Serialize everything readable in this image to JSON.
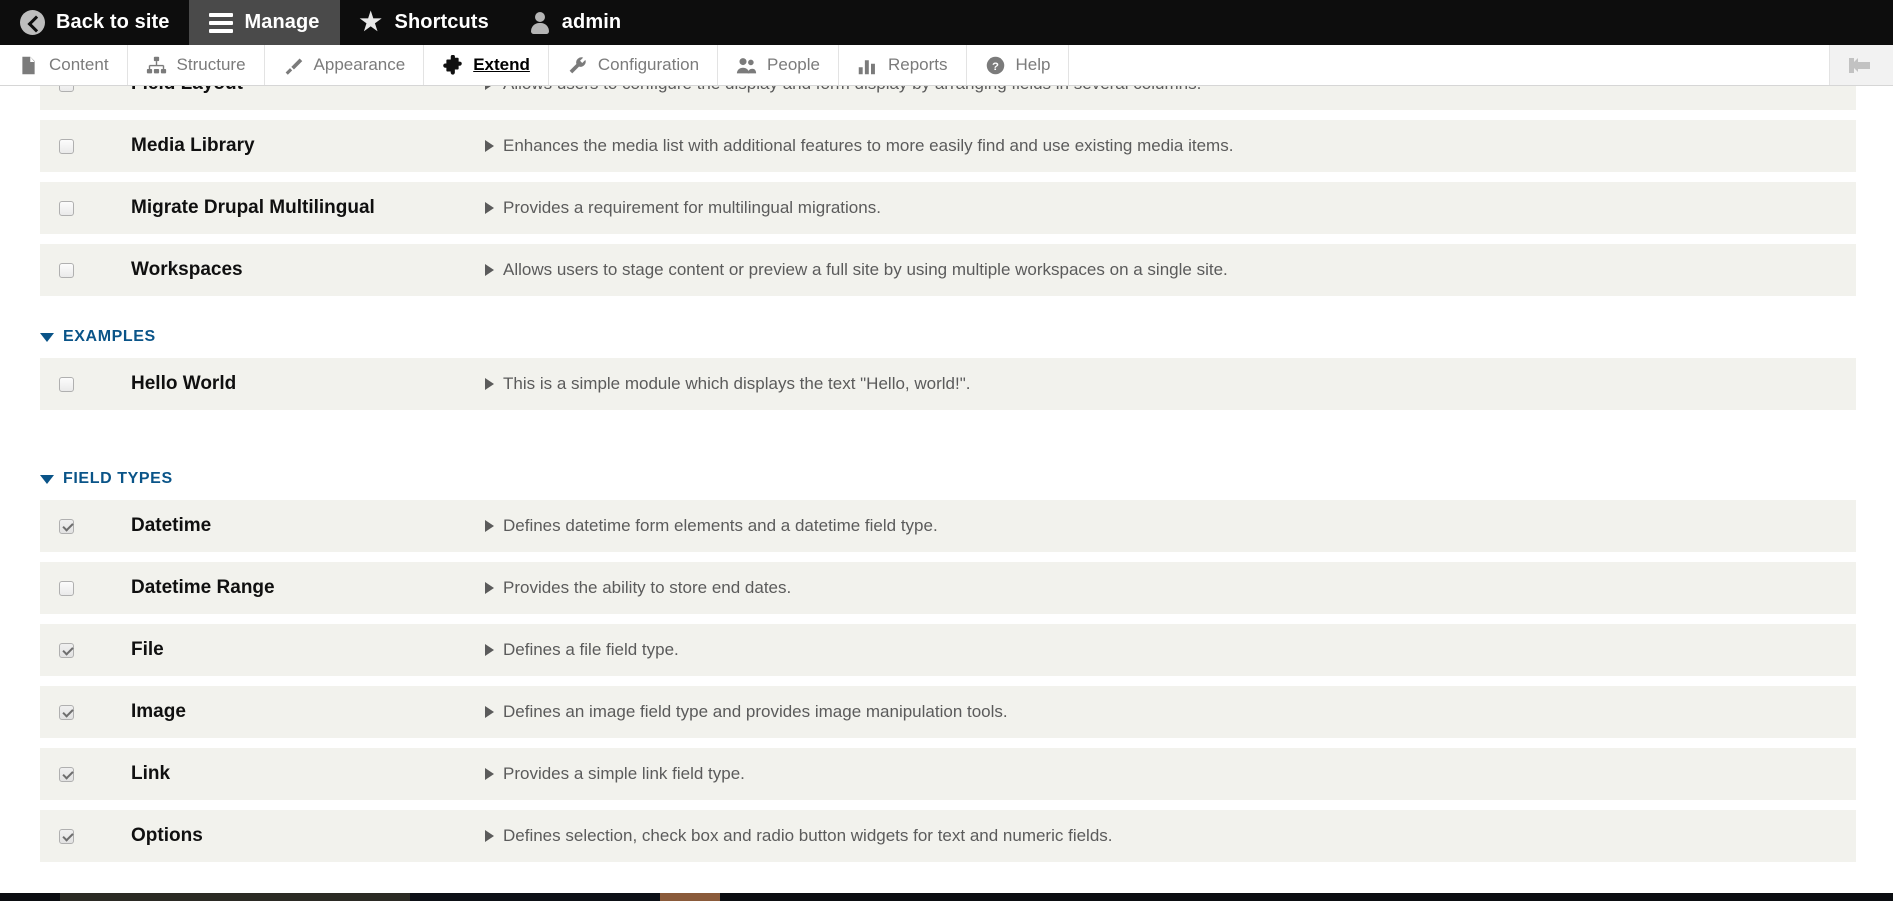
{
  "admin_bar": {
    "items": [
      {
        "label": "Back to site",
        "icon": "back-circle-icon",
        "active": false
      },
      {
        "label": "Manage",
        "icon": "hamburger-icon",
        "active": true
      },
      {
        "label": "Shortcuts",
        "icon": "star-icon",
        "active": false
      },
      {
        "label": "admin",
        "icon": "user-icon",
        "active": false
      }
    ]
  },
  "admin_tray": {
    "items": [
      {
        "label": "Content",
        "icon": "page-icon",
        "active": false
      },
      {
        "label": "Structure",
        "icon": "sitemap-icon",
        "active": false
      },
      {
        "label": "Appearance",
        "icon": "brush-icon",
        "active": false
      },
      {
        "label": "Extend",
        "icon": "puzzle-icon",
        "active": true
      },
      {
        "label": "Configuration",
        "icon": "wrench-icon",
        "active": false
      },
      {
        "label": "People",
        "icon": "people-icon",
        "active": false
      },
      {
        "label": "Reports",
        "icon": "bar-chart-icon",
        "active": false
      },
      {
        "label": "Help",
        "icon": "question-icon",
        "active": false
      }
    ],
    "orientation_toggle": "collapse-sidebar-icon"
  },
  "colors": {
    "admin_bar_bg": "#0d0d0d",
    "admin_bar_active_bg": "#4a4a4a",
    "row_bg": "#f2f2ed",
    "section_heading": "#0a5488",
    "description_text": "#5b5b5b"
  },
  "modules": {
    "top_partial_rows": [
      {
        "name": "Field Layout",
        "description": "Allows users to configure the display and form display by arranging fields in several columns.",
        "checked": false
      },
      {
        "name": "Media Library",
        "description": "Enhances the media list with additional features to more easily find and use existing media items.",
        "checked": false
      },
      {
        "name": "Migrate Drupal Multilingual",
        "description": "Provides a requirement for multilingual migrations.",
        "checked": false
      },
      {
        "name": "Workspaces",
        "description": "Allows users to stage content or preview a full site by using multiple workspaces on a single site.",
        "checked": false
      }
    ],
    "sections": [
      {
        "heading": "EXAMPLES",
        "rows": [
          {
            "name": "Hello World",
            "description": "This is a simple module which displays the text \"Hello, world!\".",
            "checked": false
          }
        ]
      },
      {
        "heading": "FIELD TYPES",
        "rows": [
          {
            "name": "Datetime",
            "description": "Defines datetime form elements and a datetime field type.",
            "checked": true
          },
          {
            "name": "Datetime Range",
            "description": "Provides the ability to store end dates.",
            "checked": false
          },
          {
            "name": "File",
            "description": "Defines a file field type.",
            "checked": true
          },
          {
            "name": "Image",
            "description": "Defines an image field type and provides image manipulation tools.",
            "checked": true
          },
          {
            "name": "Link",
            "description": "Provides a simple link field type.",
            "checked": true
          },
          {
            "name": "Options",
            "description": "Defines selection, check box and radio button widgets for text and numeric fields.",
            "checked": true
          }
        ]
      }
    ]
  }
}
